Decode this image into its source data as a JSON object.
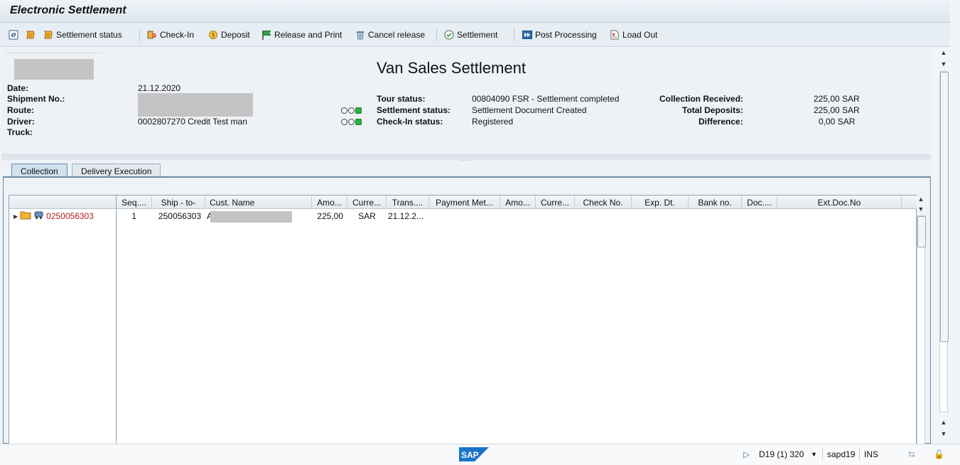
{
  "window": {
    "title": "Electronic Settlement"
  },
  "toolbar": {
    "items": [
      {
        "label": "",
        "icon": "refresh-icon"
      },
      {
        "label": "",
        "icon": "scroll-icon"
      },
      {
        "label": "Settlement status",
        "icon": "scroll-status-icon"
      },
      {
        "label": "Check-In",
        "icon": "checkin-icon"
      },
      {
        "label": "Deposit",
        "icon": "coin-icon"
      },
      {
        "label": "Release and Print",
        "icon": "green-flag-icon"
      },
      {
        "label": "Cancel release",
        "icon": "trash-icon"
      },
      {
        "label": "Settlement",
        "icon": "check-clock-icon"
      },
      {
        "label": "Post Processing",
        "icon": "fast-forward-icon"
      },
      {
        "label": "Load Out",
        "icon": "document-icon"
      }
    ]
  },
  "header": {
    "title": "Van Sales Settlement",
    "left": {
      "date_label": "Date:",
      "date_value": "21.12.2020",
      "shipment_label": "Shipment No.:",
      "route_label": "Route:",
      "driver_label": "Driver:",
      "driver_value": "0002807270 Credit Test man",
      "truck_label": "Truck:"
    },
    "middle": {
      "tour_label": "Tour status:",
      "tour_value": "00804090 FSR - Settlement completed",
      "settlement_label": "Settlement status:",
      "settlement_value": "Settlement Document Created",
      "checkin_label": "Check-In status:",
      "checkin_value": "Registered"
    },
    "right": {
      "collection_label": "Collection Received:",
      "collection_value": "225,00 SAR",
      "deposits_label": "Total Deposits:",
      "deposits_value": "225,00 SAR",
      "difference_label": "Difference:",
      "difference_value": "0,00 SAR"
    },
    "traffic_light_color": "#27b53d"
  },
  "tabs": [
    {
      "label": "Collection",
      "active": true
    },
    {
      "label": "Delivery Execution",
      "active": false
    }
  ],
  "grid": {
    "columns": [
      "Seq....",
      "Ship - to-",
      "Cust. Name",
      "Amo...",
      "Curre...",
      "Trans....",
      "Payment Met...",
      "Amo...",
      "Curre...",
      "Check No.",
      "Exp. Dt.",
      "Bank no.",
      "Doc....",
      "Ext.Doc.No"
    ],
    "tree_node": "0250056303",
    "rows": [
      {
        "seq": "1",
        "ship_to": "250056303",
        "cust_name": "A",
        "amount": "225,00",
        "currency": "SAR",
        "trans": "21.12.2..."
      }
    ]
  },
  "statusbar": {
    "system": "D19 (1) 320",
    "server": "sapd19",
    "mode": "INS"
  }
}
